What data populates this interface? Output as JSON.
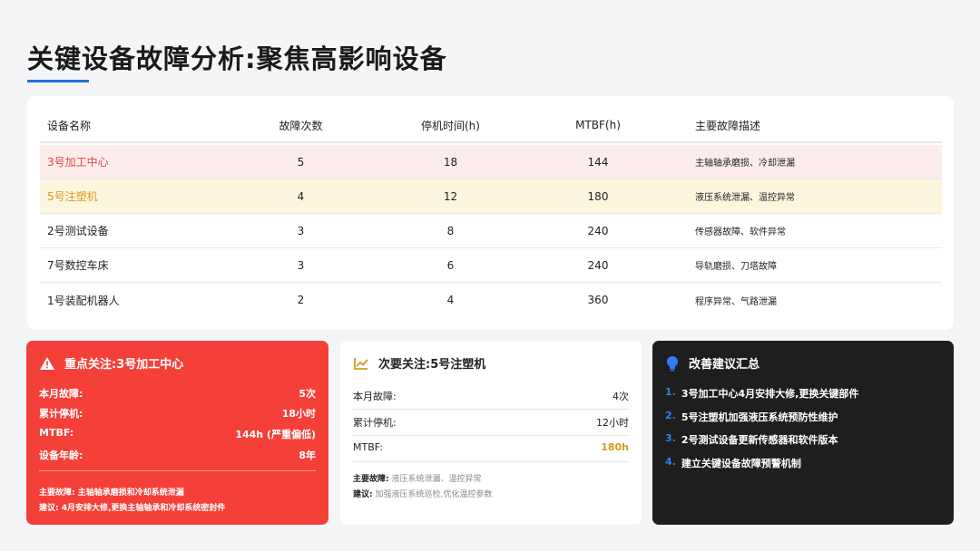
{
  "title": "关键设备故障分析:聚焦高影响设备",
  "colors": {
    "accent": "#1f6fd6",
    "critical": "#f5403a",
    "warning": "#d49a1c",
    "dark": "#1e1e1e"
  },
  "table": {
    "headers": [
      "设备名称",
      "故障次数",
      "停机时间(h)",
      "MTBF(h)",
      "主要故障描述"
    ],
    "rows": [
      {
        "name": "3号加工中心",
        "failures": "5",
        "downtime": "18",
        "mtbf": "144",
        "desc": "主轴轴承磨损、冷却泄漏",
        "highlight": "red"
      },
      {
        "name": "5号注塑机",
        "failures": "4",
        "downtime": "12",
        "mtbf": "180",
        "desc": "液压系统泄漏、温控异常",
        "highlight": "yellow"
      },
      {
        "name": "2号测试设备",
        "failures": "3",
        "downtime": "8",
        "mtbf": "240",
        "desc": "传感器故障、软件异常",
        "highlight": "none"
      },
      {
        "name": "7号数控车床",
        "failures": "3",
        "downtime": "6",
        "mtbf": "240",
        "desc": "导轨磨损、刀塔故障",
        "highlight": "none"
      },
      {
        "name": "1号装配机器人",
        "failures": "2",
        "downtime": "4",
        "mtbf": "360",
        "desc": "程序异常、气路泄漏",
        "highlight": "none"
      }
    ]
  },
  "focus_primary": {
    "icon": "warning-icon",
    "title": "重点关注:3号加工中心",
    "items": [
      {
        "label": "本月故障:",
        "value": "5次"
      },
      {
        "label": "累计停机:",
        "value": "18小时"
      },
      {
        "label": "MTBF:",
        "value": "144h (严重偏低)"
      },
      {
        "label": "设备年龄:",
        "value": "8年"
      }
    ],
    "note1": "主要故障: 主轴轴承磨损和冷却系统泄漏",
    "note2": "建议: 4月安排大修,更换主轴轴承和冷却系统密封件"
  },
  "focus_secondary": {
    "icon": "trend-icon",
    "title": "次要关注:5号注塑机",
    "items": [
      {
        "label": "本月故障:",
        "value": "4次"
      },
      {
        "label": "累计停机:",
        "value": "12小时"
      },
      {
        "label": "MTBF:",
        "value": "180h"
      }
    ],
    "note1_label": "主要故障:",
    "note1_value": "液压系统泄漏、温控异常",
    "note2_label": "建议:",
    "note2_value": "加强液压系统巡检,优化温控参数"
  },
  "suggestions": {
    "icon": "lightbulb-icon",
    "title": "改善建议汇总",
    "items": [
      {
        "num": "1.",
        "text": "3号加工中心4月安排大修,更换关键部件"
      },
      {
        "num": "2.",
        "text": "5号注塑机加强液压系统预防性维护"
      },
      {
        "num": "3.",
        "text": "2号测试设备更新传感器和软件版本"
      },
      {
        "num": "4.",
        "text": "建立关键设备故障预警机制"
      }
    ]
  }
}
